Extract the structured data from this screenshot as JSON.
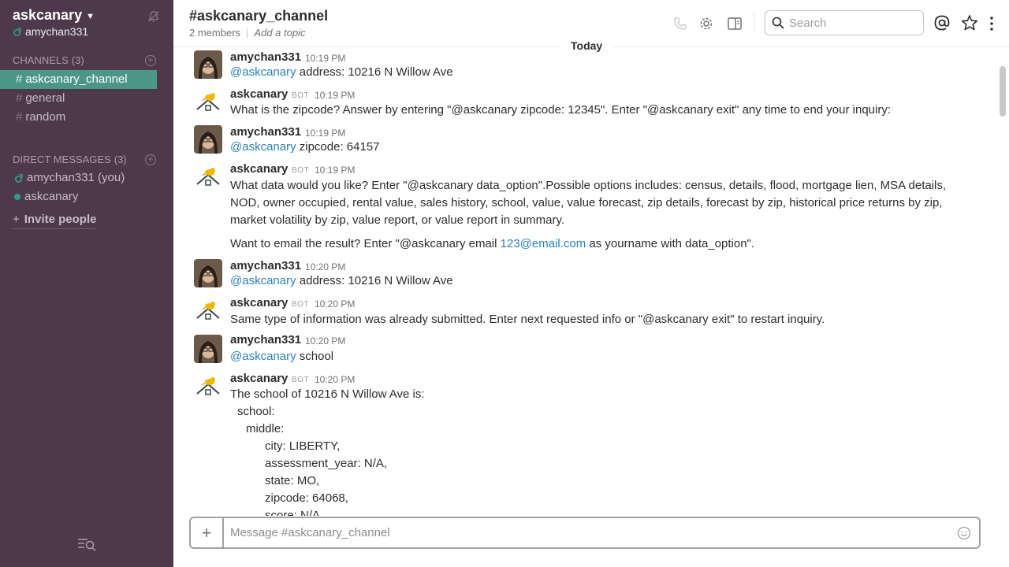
{
  "sidebar": {
    "team_name": "askcanary",
    "user_name": "amychan331",
    "channels_heading": "CHANNELS",
    "channels_count": "(3)",
    "channels": [
      {
        "name": "askcanary_channel",
        "active": true
      },
      {
        "name": "general"
      },
      {
        "name": "random"
      }
    ],
    "dm_heading": "DIRECT MESSAGES",
    "dm_count": "(3)",
    "dms": [
      {
        "name": "amychan331 (you)"
      },
      {
        "name": "askcanary"
      }
    ],
    "invite_label": "Invite people"
  },
  "header": {
    "channel_title": "#askcanary_channel",
    "members": "2 members",
    "topic": "Add a topic",
    "search_placeholder": "Search"
  },
  "day_divider": "Today",
  "messages": [
    {
      "sender": "amychan331",
      "time": "10:19 PM",
      "mention": "@askcanary",
      "text": " address: 10216 N Willow Ave"
    },
    {
      "sender": "askcanary",
      "bot": "BOT",
      "time": "10:19 PM",
      "text": "What is the zipcode? Answer by entering \"@askcanary zipcode: 12345\". Enter \"@askcanary exit\" any time to end your inquiry:"
    },
    {
      "sender": "amychan331",
      "time": "10:19 PM",
      "mention": "@askcanary",
      "text": " zipcode: 64157"
    },
    {
      "sender": "askcanary",
      "bot": "BOT",
      "time": "10:19 PM",
      "text": "What data would you like? Enter \"@askcanary data_option\".Possible options includes: census, details, flood, mortgage lien, MSA details, NOD, owner occupied, rental value, sales history, school, value, value forecast, zip details, forecast by zip, historical price returns by zip, market volatility by zip, value report, or value report in summary.",
      "text2_pre": "Want to email the result? Enter \"@askcanary email ",
      "text2_link": "123@email.com",
      "text2_post": " as yourname with data_option\"."
    },
    {
      "sender": "amychan331",
      "time": "10:20 PM",
      "mention": "@askcanary",
      "text": " address: 10216 N Willow Ave"
    },
    {
      "sender": "askcanary",
      "bot": "BOT",
      "time": "10:20 PM",
      "text": "Same type of information was already submitted. Enter next requested info or \"@askcanary exit\" to restart inquiry."
    },
    {
      "sender": "amychan331",
      "time": "10:20 PM",
      "mention": "@askcanary",
      "text": " school"
    },
    {
      "sender": "askcanary",
      "bot": "BOT",
      "time": "10:20 PM",
      "lines": [
        "The school of 10216 N Willow Ave is:",
        "school:",
        "middle:",
        "city: LIBERTY,",
        "assessment_year: N/A,",
        "state: MO,",
        "zipcode: 64068,",
        "score: N/A"
      ]
    }
  ],
  "composer": {
    "placeholder": "Message #askcanary_channel"
  },
  "colors": {
    "sidebar_bg": "#4d394b",
    "active_channel": "#4c9689",
    "link": "#2a80b9"
  }
}
